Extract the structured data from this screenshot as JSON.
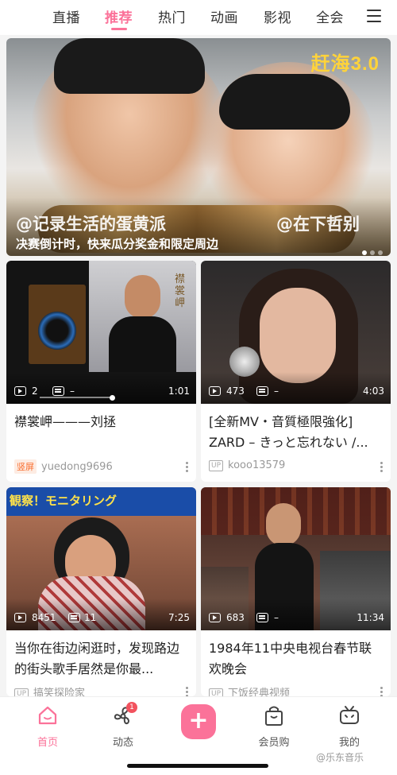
{
  "topnav": {
    "tabs": [
      {
        "label": "直播"
      },
      {
        "label": "推荐"
      },
      {
        "label": "热门"
      },
      {
        "label": "动画"
      },
      {
        "label": "影视"
      },
      {
        "label": "全会"
      }
    ],
    "active_tab": "推荐",
    "menu_icon": "menu-icon"
  },
  "banner": {
    "badge": "赶海3.0",
    "watermark_left": "@记录生活的蛋黄派",
    "watermark_right": "@在下哲别",
    "caption": "决赛倒计时，快来瓜分奖金和限定周边",
    "page_count": 3,
    "current_page": 1
  },
  "cards": [
    {
      "plays": "2",
      "danmaku": "–",
      "duration": "1:01",
      "title": "襟裳岬———刘拯",
      "tag": "竖屏",
      "author": "yuedong9696",
      "thumb_overlay": "襟裳岬"
    },
    {
      "plays": "473",
      "danmaku": "–",
      "duration": "4:03",
      "title": "[全新MV・音質極限強化] ZARD – きっと忘れない /...",
      "tag": "UP",
      "author": "kooo13579"
    },
    {
      "plays": "8451",
      "danmaku": "11",
      "duration": "7:25",
      "title": "当你在街边闲逛时，发现路边的街头歌手居然是你最...",
      "tag": "UP",
      "author": "搞笑探险家",
      "thumb_overlay": "観察！モニタリング"
    },
    {
      "plays": "683",
      "danmaku": "–",
      "duration": "11:34",
      "title": "1984年11中央电视台春节联欢晚会",
      "tag": "UP",
      "author": "下饭经典视频"
    }
  ],
  "bottomnav": {
    "items": [
      {
        "label": "首页",
        "icon": "home-icon"
      },
      {
        "label": "动态",
        "icon": "fan-icon",
        "badge": "1"
      },
      {
        "label": "",
        "icon": "plus-icon"
      },
      {
        "label": "会员购",
        "icon": "shopping-bag-icon"
      },
      {
        "label": "我的",
        "icon": "tv-icon"
      }
    ],
    "plus": "+"
  },
  "watermark": "@乐东音乐",
  "colors": {
    "accent": "#fb7299",
    "tag_orange": "#f96f30"
  }
}
